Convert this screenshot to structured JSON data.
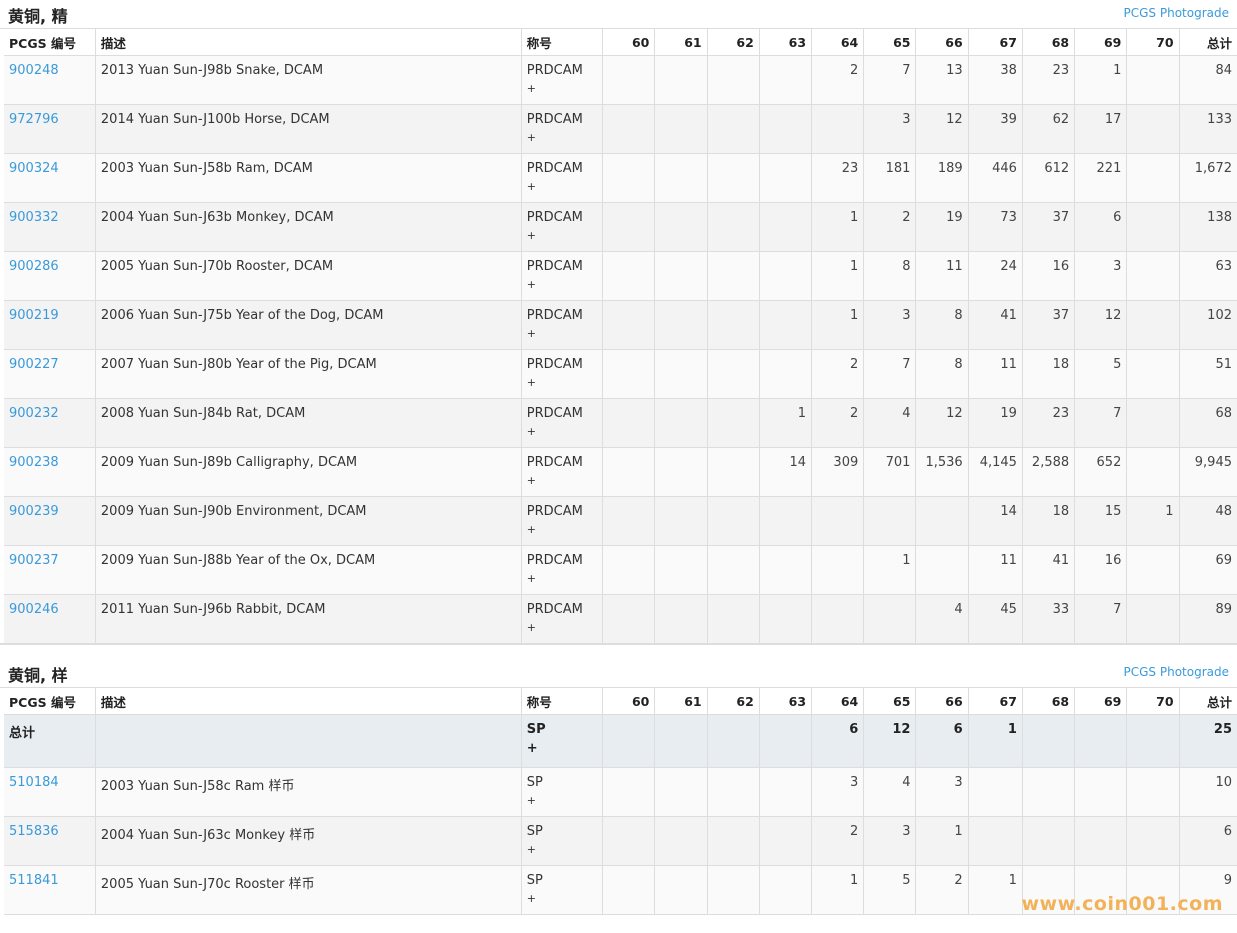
{
  "columns": [
    "PCGS 编号",
    "描述",
    "称号",
    "60",
    "61",
    "62",
    "63",
    "64",
    "65",
    "66",
    "67",
    "68",
    "69",
    "70",
    "总计"
  ],
  "section1": {
    "title": "黄铜, 精",
    "link": "PCGS Photograde",
    "rows": [
      {
        "code": "900248",
        "desc": "2013 Yuan Sun-J98b Snake, DCAM",
        "des": "PRDCAM",
        "plus": "+",
        "vals": [
          "",
          "",
          "",
          "",
          "2",
          "7",
          "13",
          "38",
          "23",
          "1",
          ""
        ],
        "total": "84"
      },
      {
        "code": "972796",
        "desc": "2014 Yuan Sun-J100b Horse, DCAM",
        "des": "PRDCAM",
        "plus": "+",
        "vals": [
          "",
          "",
          "",
          "",
          "",
          "3",
          "12",
          "39",
          "62",
          "17",
          ""
        ],
        "total": "133"
      },
      {
        "code": "900324",
        "desc": "2003 Yuan Sun-J58b Ram, DCAM",
        "des": "PRDCAM",
        "plus": "+",
        "vals": [
          "",
          "",
          "",
          "",
          "23",
          "181",
          "189",
          "446",
          "612",
          "221",
          ""
        ],
        "total": "1,672"
      },
      {
        "code": "900332",
        "desc": "2004 Yuan Sun-J63b Monkey, DCAM",
        "des": "PRDCAM",
        "plus": "+",
        "vals": [
          "",
          "",
          "",
          "",
          "1",
          "2",
          "19",
          "73",
          "37",
          "6",
          ""
        ],
        "total": "138"
      },
      {
        "code": "900286",
        "desc": "2005 Yuan Sun-J70b Rooster, DCAM",
        "des": "PRDCAM",
        "plus": "+",
        "vals": [
          "",
          "",
          "",
          "",
          "1",
          "8",
          "11",
          "24",
          "16",
          "3",
          ""
        ],
        "total": "63"
      },
      {
        "code": "900219",
        "desc": "2006 Yuan Sun-J75b Year of the Dog, DCAM",
        "des": "PRDCAM",
        "plus": "+",
        "vals": [
          "",
          "",
          "",
          "",
          "1",
          "3",
          "8",
          "41",
          "37",
          "12",
          ""
        ],
        "total": "102"
      },
      {
        "code": "900227",
        "desc": "2007 Yuan Sun-J80b Year of the Pig, DCAM",
        "des": "PRDCAM",
        "plus": "+",
        "vals": [
          "",
          "",
          "",
          "",
          "2",
          "7",
          "8",
          "11",
          "18",
          "5",
          ""
        ],
        "total": "51"
      },
      {
        "code": "900232",
        "desc": "2008 Yuan Sun-J84b Rat, DCAM",
        "des": "PRDCAM",
        "plus": "+",
        "vals": [
          "",
          "",
          "",
          "1",
          "2",
          "4",
          "12",
          "19",
          "23",
          "7",
          ""
        ],
        "total": "68"
      },
      {
        "code": "900238",
        "desc": "2009 Yuan Sun-J89b Calligraphy, DCAM",
        "des": "PRDCAM",
        "plus": "+",
        "vals": [
          "",
          "",
          "",
          "14",
          "309",
          "701",
          "1,536",
          "4,145",
          "2,588",
          "652",
          ""
        ],
        "total": "9,945"
      },
      {
        "code": "900239",
        "desc": "2009 Yuan Sun-J90b Environment, DCAM",
        "des": "PRDCAM",
        "plus": "+",
        "vals": [
          "",
          "",
          "",
          "",
          "",
          "",
          "",
          "14",
          "18",
          "15",
          "1"
        ],
        "total": "48"
      },
      {
        "code": "900237",
        "desc": "2009 Yuan Sun-J88b Year of the Ox, DCAM",
        "des": "PRDCAM",
        "plus": "+",
        "vals": [
          "",
          "",
          "",
          "",
          "",
          "1",
          "",
          "11",
          "41",
          "16",
          ""
        ],
        "total": "69"
      },
      {
        "code": "900246",
        "desc": "2011 Yuan Sun-J96b Rabbit, DCAM",
        "des": "PRDCAM",
        "plus": "+",
        "vals": [
          "",
          "",
          "",
          "",
          "",
          "",
          "4",
          "45",
          "33",
          "7",
          ""
        ],
        "total": "89"
      }
    ]
  },
  "section2": {
    "title": "黄铜, 样",
    "link": "PCGS Photograde",
    "total_row": {
      "label": "总计",
      "des": "SP",
      "plus": "+",
      "vals": [
        "",
        "",
        "",
        "",
        "6",
        "12",
        "6",
        "1",
        "",
        "",
        ""
      ],
      "total": "25"
    },
    "rows": [
      {
        "code": "510184",
        "desc": "2003 Yuan Sun-J58c Ram 样币",
        "des": "SP",
        "plus": "+",
        "vals": [
          "",
          "",
          "",
          "",
          "3",
          "4",
          "3",
          "",
          "",
          "",
          ""
        ],
        "total": "10"
      },
      {
        "code": "515836",
        "desc": "2004 Yuan Sun-J63c Monkey 样币",
        "des": "SP",
        "plus": "+",
        "vals": [
          "",
          "",
          "",
          "",
          "2",
          "3",
          "1",
          "",
          "",
          "",
          ""
        ],
        "total": "6"
      },
      {
        "code": "511841",
        "desc": "2005 Yuan Sun-J70c Rooster 样币",
        "des": "SP",
        "plus": "+",
        "vals": [
          "",
          "",
          "",
          "",
          "1",
          "5",
          "2",
          "1",
          "",
          "",
          ""
        ],
        "total": "9"
      }
    ]
  },
  "watermark": "www.coin001.com"
}
